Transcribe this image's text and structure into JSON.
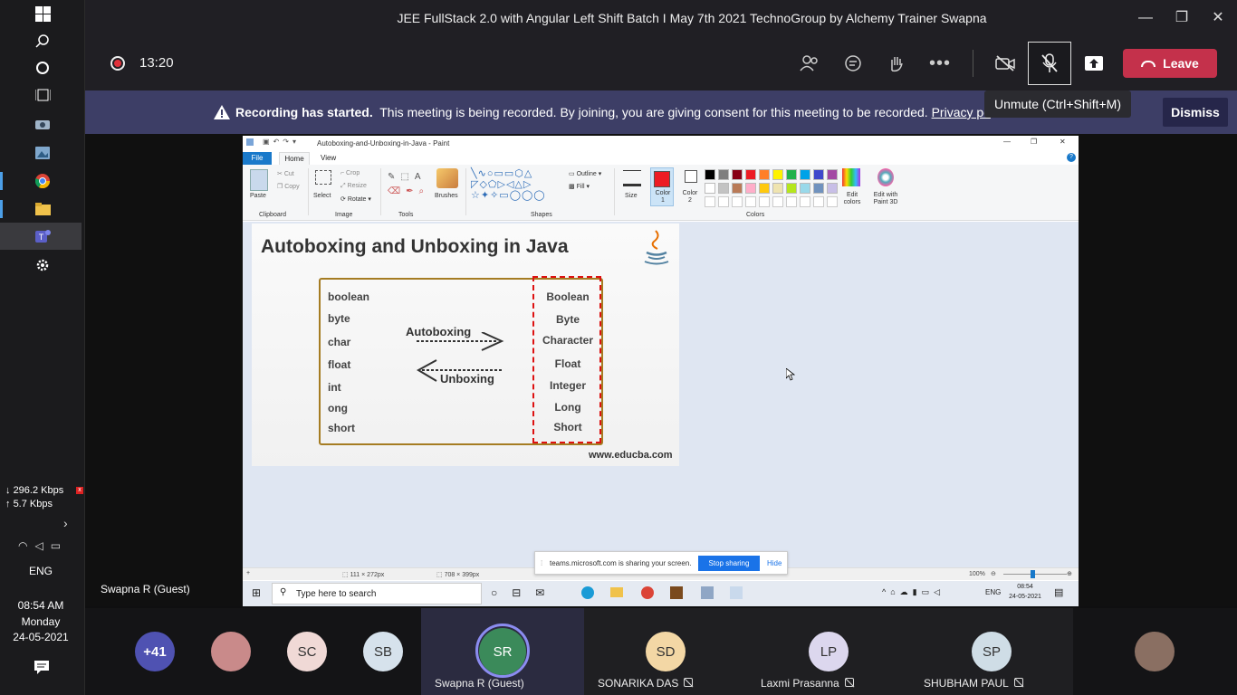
{
  "window": {
    "title": "JEE FullStack 2.0 with Angular Left Shift Batch I May 7th 2021 TechnoGroup by Alchemy Trainer Swapna"
  },
  "call": {
    "timer": "13:20",
    "leave_label": "Leave",
    "tooltip": "Unmute (Ctrl+Shift+M)"
  },
  "banner": {
    "bold": "Recording has started.",
    "text": "This meeting is being recorded. By joining, you are giving consent for this meeting to be recorded.",
    "link": "Privacy po",
    "dismiss": "Dismiss"
  },
  "sidebar": {
    "net_down": "296.2 Kbps",
    "net_up": "5.7 Kbps",
    "lang": "ENG",
    "time": "08:54 AM",
    "day": "Monday",
    "date": "24-05-2021"
  },
  "presenter": {
    "label": "Swapna R (Guest)"
  },
  "paint": {
    "title": "Autoboxing-and-Unboxing-in-Java - Paint",
    "tabs": [
      "File",
      "Home",
      "View"
    ],
    "clipboard": {
      "paste": "Paste",
      "cut": "Cut",
      "copy": "Copy",
      "group": "Clipboard"
    },
    "image": {
      "select": "Select",
      "crop": "Crop",
      "resize": "Resize",
      "rotate": "Rotate",
      "group": "Image"
    },
    "tools": {
      "group": "Tools",
      "brushes": "Brushes"
    },
    "shapes": {
      "outline": "Outline",
      "fill": "Fill",
      "group": "Shapes",
      "size": "Size"
    },
    "colors": {
      "color1": "Color 1",
      "color2": "Color 2",
      "edit": "Edit colors",
      "edit3d": "Edit with Paint 3D",
      "group": "Colors",
      "palette": [
        "#000000",
        "#7f7f7f",
        "#880015",
        "#ed1c24",
        "#ff7f27",
        "#fff200",
        "#22b14c",
        "#00a2e8",
        "#3f48cc",
        "#a349a4",
        "#ffffff",
        "#c3c3c3",
        "#b97a57",
        "#ffaec9",
        "#ffc90e",
        "#efe4b0",
        "#b5e61d",
        "#99d9ea",
        "#7092be",
        "#c8bfe7"
      ]
    },
    "status": {
      "dims": "111 × 272px",
      "size": "708 × 399px",
      "zoom": "100%"
    }
  },
  "slide": {
    "title": "Autoboxing and Unboxing in Java",
    "primitives": [
      "boolean",
      "byte",
      "char",
      "float",
      "int",
      "ong",
      "short"
    ],
    "wrappers": [
      "Boolean",
      "Byte",
      "Character",
      "Float",
      "Integer",
      "Long",
      "Short"
    ],
    "autoboxing": "Autoboxing",
    "unboxing": "Unboxing",
    "footer": "www.educba.com"
  },
  "sharing": {
    "text": "teams.microsoft.com is sharing your screen.",
    "stop": "Stop sharing",
    "hide": "Hide"
  },
  "inner_taskbar": {
    "search": "Type here to search",
    "lang": "ENG",
    "time": "08:54",
    "date": "24-05-2021"
  },
  "participants": [
    {
      "initials": "+41",
      "name": "",
      "color": "#4f52b2"
    },
    {
      "initials": "",
      "name": "",
      "color": "#c98a8a"
    },
    {
      "initials": "SC",
      "name": "",
      "color": "#f0d9d6"
    },
    {
      "initials": "SB",
      "name": "",
      "color": "#d6e2ec"
    },
    {
      "initials": "SR",
      "name": "Swapna R (Guest)",
      "color": "#3b8a5a"
    },
    {
      "initials": "SD",
      "name": "SONARIKA DAS",
      "color": "#f3d7a5"
    },
    {
      "initials": "LP",
      "name": "Laxmi Prasanna",
      "color": "#dcd7ee"
    },
    {
      "initials": "SP",
      "name": "SHUBHAM PAUL",
      "color": "#cfdde6"
    },
    {
      "initials": "",
      "name": "",
      "color": "#8a6f62"
    }
  ]
}
